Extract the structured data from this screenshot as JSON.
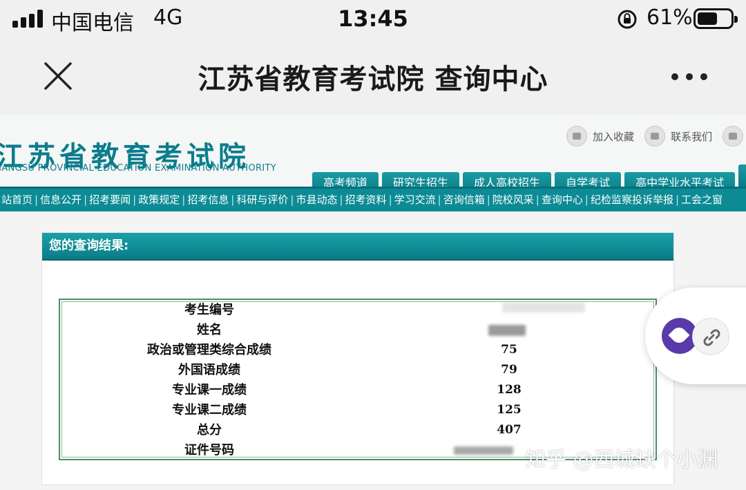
{
  "status_bar": {
    "carrier": "中国电信",
    "network": "4G",
    "time": "13:45",
    "battery_percent": "61%",
    "battery_level": 0.61
  },
  "title_bar": {
    "title": "江苏省教育考试院 查询中心",
    "close_icon": "close-icon",
    "more_icon": "more-dots-icon"
  },
  "site": {
    "logo_cn": "江苏省教育考试院",
    "logo_en": "JIANGSU PROVINCIAL EDUCATION EXAMINATION AUTHORITY",
    "top_links": [
      "加入收藏",
      "联系我们"
    ],
    "tabs": [
      "高考频道",
      "研究生招生",
      "成人高校招生",
      "自学考试",
      "高中学业水平考试"
    ],
    "nav": [
      "站首页",
      "信息公开",
      "招考要闻",
      "政策规定",
      "招考信息",
      "科研与评价",
      "市县动态",
      "招考资料",
      "学习交流",
      "咨询信箱",
      "院校风采",
      "查询中心",
      "纪检监察投诉举报",
      "工会之窗"
    ],
    "nav_sep": "|"
  },
  "result": {
    "header": "您的查询结果:",
    "rows": [
      {
        "label": "考生编号",
        "value": ""
      },
      {
        "label": "姓名",
        "value": ""
      },
      {
        "label": "政治或管理类综合成绩",
        "value": "75"
      },
      {
        "label": "外国语成绩",
        "value": "79"
      },
      {
        "label": "专业课一成绩",
        "value": "128"
      },
      {
        "label": "专业课二成绩",
        "value": "125"
      },
      {
        "label": "总分",
        "value": "407"
      },
      {
        "label": "证件号码",
        "value": ""
      }
    ]
  },
  "watermark": "知乎 @西城缺个小渊",
  "colors": {
    "accent": "#0c8b95",
    "box_border": "#4f8c63"
  }
}
